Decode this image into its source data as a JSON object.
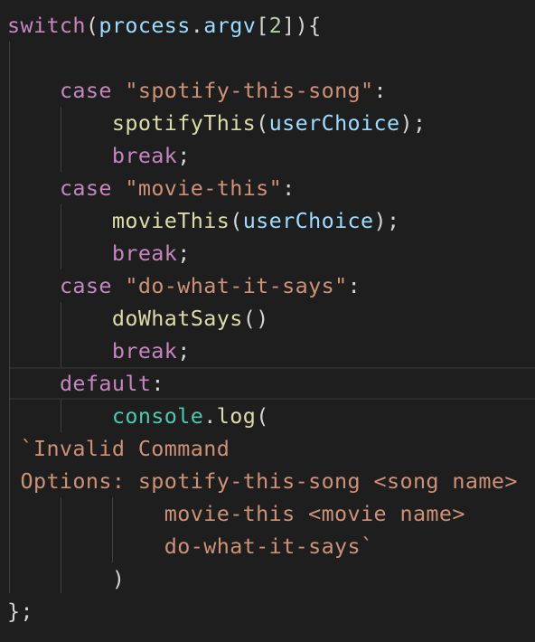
{
  "editor": {
    "language": "javascript",
    "theme_colors": {
      "background": "#1e1e1e",
      "keyword": "#c586c0",
      "variable": "#9cdcfe",
      "object": "#4ec9b0",
      "function": "#dcdcaa",
      "string": "#ce9178",
      "number": "#b5cea8",
      "punctuation": "#d4d4d4"
    },
    "lines": [
      {
        "tokens": [
          [
            "switch",
            "ctl"
          ],
          [
            "(",
            "punc"
          ],
          [
            "process",
            "var"
          ],
          [
            ".",
            "punc"
          ],
          [
            "argv",
            "var"
          ],
          [
            "[",
            "punc"
          ],
          [
            "2",
            "num"
          ],
          [
            "]",
            "punc"
          ],
          [
            ")",
            "punc"
          ],
          [
            "{",
            "punc"
          ]
        ]
      },
      {
        "tokens": []
      },
      {
        "tokens": [
          [
            "    ",
            "punc"
          ],
          [
            "case",
            "ctl"
          ],
          [
            " ",
            "punc"
          ],
          [
            "\"spotify-this-song\"",
            "str"
          ],
          [
            ":",
            "punc"
          ]
        ]
      },
      {
        "tokens": [
          [
            "        ",
            "punc"
          ],
          [
            "spotifyThis",
            "fn"
          ],
          [
            "(",
            "punc"
          ],
          [
            "userChoice",
            "var"
          ],
          [
            ");",
            "punc"
          ]
        ]
      },
      {
        "tokens": [
          [
            "        ",
            "punc"
          ],
          [
            "break",
            "ctl"
          ],
          [
            ";",
            "punc"
          ]
        ]
      },
      {
        "tokens": [
          [
            "    ",
            "punc"
          ],
          [
            "case",
            "ctl"
          ],
          [
            " ",
            "punc"
          ],
          [
            "\"movie-this\"",
            "str"
          ],
          [
            ":",
            "punc"
          ]
        ]
      },
      {
        "tokens": [
          [
            "        ",
            "punc"
          ],
          [
            "movieThis",
            "fn"
          ],
          [
            "(",
            "punc"
          ],
          [
            "userChoice",
            "var"
          ],
          [
            ");",
            "punc"
          ]
        ]
      },
      {
        "tokens": [
          [
            "        ",
            "punc"
          ],
          [
            "break",
            "ctl"
          ],
          [
            ";",
            "punc"
          ]
        ]
      },
      {
        "tokens": [
          [
            "    ",
            "punc"
          ],
          [
            "case",
            "ctl"
          ],
          [
            " ",
            "punc"
          ],
          [
            "\"do-what-it-says\"",
            "str"
          ],
          [
            ":",
            "punc"
          ]
        ]
      },
      {
        "tokens": [
          [
            "        ",
            "punc"
          ],
          [
            "doWhatSays",
            "fn"
          ],
          [
            "()",
            "punc"
          ]
        ]
      },
      {
        "tokens": [
          [
            "        ",
            "punc"
          ],
          [
            "break",
            "ctl"
          ],
          [
            ";",
            "punc"
          ]
        ]
      },
      {
        "tokens": [
          [
            "    ",
            "punc"
          ],
          [
            "default",
            "ctl"
          ],
          [
            ":",
            "punc"
          ]
        ]
      },
      {
        "tokens": [
          [
            "        ",
            "punc"
          ],
          [
            "console",
            "obj"
          ],
          [
            ".",
            "punc"
          ],
          [
            "log",
            "fn"
          ],
          [
            "(",
            "punc"
          ]
        ]
      },
      {
        "tokens": [
          [
            " `Invalid Command",
            "str"
          ]
        ]
      },
      {
        "tokens": [
          [
            " Options: spotify-this-song <song name>",
            "str"
          ]
        ]
      },
      {
        "tokens": [
          [
            "            movie-this <movie name>",
            "str"
          ]
        ]
      },
      {
        "tokens": [
          [
            "            do-what-it-says`",
            "str"
          ]
        ]
      },
      {
        "tokens": [
          [
            "        ",
            "punc"
          ],
          [
            ")",
            "punc"
          ]
        ]
      },
      {
        "tokens": [
          [
            "};",
            "punc"
          ]
        ]
      }
    ]
  }
}
